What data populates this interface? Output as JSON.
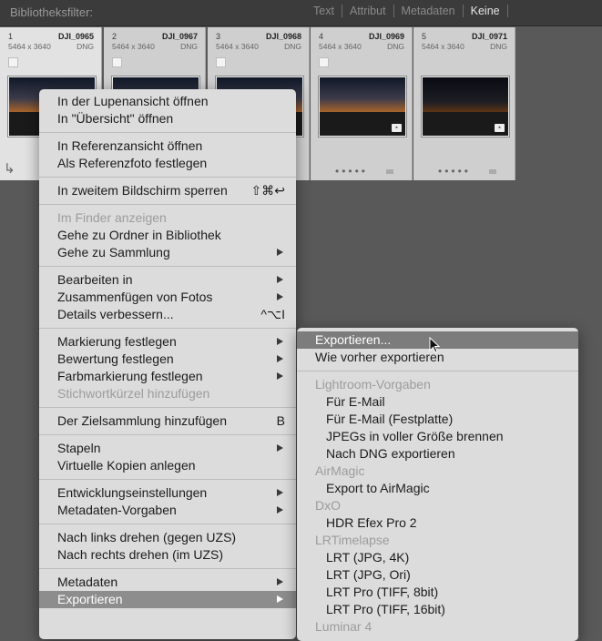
{
  "filterbar": {
    "title": "Bibliotheksfilter:",
    "tabs": [
      "Text",
      "Attribut",
      "Metadaten",
      "Keine"
    ],
    "active_index": 3
  },
  "photos": [
    {
      "num": "1",
      "name": "DJI_0965",
      "dims": "5464 x 3640",
      "type": "DNG"
    },
    {
      "num": "2",
      "name": "DJI_0967",
      "dims": "5464 x 3640",
      "type": "DNG"
    },
    {
      "num": "3",
      "name": "DJI_0968",
      "dims": "5464 x 3640",
      "type": "DNG"
    },
    {
      "num": "4",
      "name": "DJI_0969",
      "dims": "5464 x 3640",
      "type": "DNG"
    },
    {
      "num": "5",
      "name": "DJI_0971",
      "dims": "5464 x 3640",
      "type": "DNG"
    }
  ],
  "context_menu": {
    "items": [
      "In der Lupenansicht öffnen",
      "In \"Übersicht\" öffnen",
      "In Referenzansicht öffnen",
      "Als Referenzfoto festlegen",
      "In zweitem Bildschirm sperren",
      "Im Finder anzeigen",
      "Gehe zu Ordner in Bibliothek",
      "Gehe zu Sammlung",
      "Bearbeiten in",
      "Zusammenfügen von Fotos",
      "Details verbessern...",
      "Markierung festlegen",
      "Bewertung festlegen",
      "Farbmarkierung festlegen",
      "Stichwortkürzel hinzufügen",
      "Der Zielsammlung hinzufügen",
      "Stapeln",
      "Virtuelle Kopien anlegen",
      "Entwicklungseinstellungen",
      "Metadaten-Vorgaben",
      "Nach links drehen (gegen UZS)",
      "Nach rechts drehen (im UZS)",
      "Metadaten",
      "Exportieren"
    ],
    "shortcuts": {
      "second_screen": "⇧⌘↩",
      "enhance": "^⌥I",
      "target_collection": "B"
    }
  },
  "export_submenu": {
    "items": [
      "Exportieren...",
      "Wie vorher exportieren",
      "Lightroom-Vorgaben",
      "Für E-Mail",
      "Für E-Mail (Festplatte)",
      "JPEGs in voller Größe brennen",
      "Nach DNG exportieren",
      "AirMagic",
      "Export to AirMagic",
      "DxO",
      "HDR Efex Pro 2",
      "LRTimelapse",
      "LRT (JPG, 4K)",
      "LRT (JPG, Ori)",
      "LRT Pro (TIFF, 8bit)",
      "LRT Pro (TIFF, 16bit)",
      "Luminar 4"
    ]
  }
}
